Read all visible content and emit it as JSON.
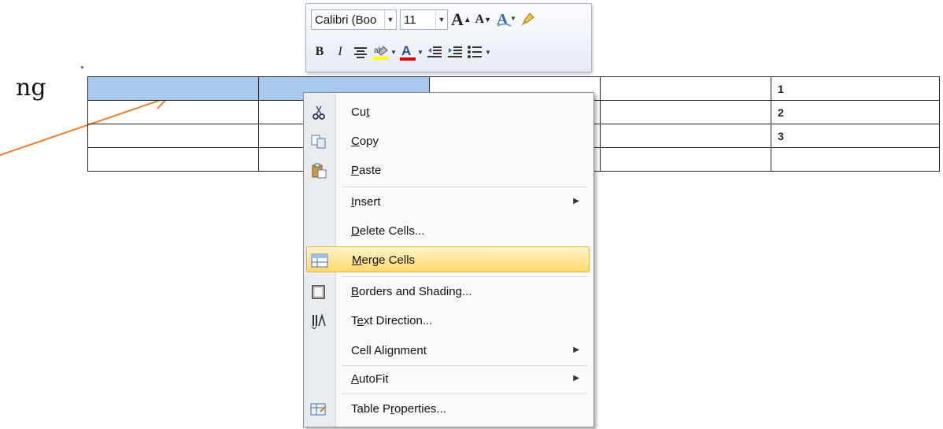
{
  "side_text": "ng",
  "mini_toolbar": {
    "font_value": "Calibri (Boo",
    "size_value": "11",
    "grow_font": "A",
    "shrink_font": "A",
    "bold": "B",
    "italic": "I",
    "font_color": "A",
    "highlight": "ab"
  },
  "table": {
    "rows": [
      [
        "",
        "",
        "",
        "",
        "1"
      ],
      [
        "",
        "",
        "",
        "",
        "2"
      ],
      [
        "",
        "",
        "",
        "",
        "3"
      ],
      [
        "",
        "",
        "",
        "",
        ""
      ]
    ]
  },
  "context_menu": {
    "items": [
      {
        "label": "Cut",
        "accel_index": 2,
        "icon": "scissors-icon"
      },
      {
        "label": "Copy",
        "accel_index": 0,
        "icon": "copy-icon"
      },
      {
        "label": "Paste",
        "accel_index": 0,
        "icon": "paste-icon"
      },
      {
        "label": "Insert",
        "accel_index": 0,
        "submenu": true
      },
      {
        "label": "Delete Cells...",
        "accel_index": 0
      },
      {
        "label": "Merge Cells",
        "accel_index": 0,
        "icon": "merge-cells-icon",
        "highlighted": true
      },
      {
        "label": "Borders and Shading...",
        "accel_index": 0,
        "icon": "borders-icon"
      },
      {
        "label": "Text Direction...",
        "accel_index": 1,
        "icon": "text-direction-icon"
      },
      {
        "label": "Cell Alignment",
        "accel_index": 8,
        "submenu": true
      },
      {
        "label": "AutoFit",
        "accel_index": 0,
        "submenu": true
      },
      {
        "label": "Table Properties...",
        "accel_index": 7,
        "icon": "table-properties-icon"
      }
    ]
  },
  "colors": {
    "selection": "#a8c9ee",
    "arrow": "#ed7d31",
    "menu_highlight": "#ffd86b",
    "font_color_underline": "#e00000"
  }
}
